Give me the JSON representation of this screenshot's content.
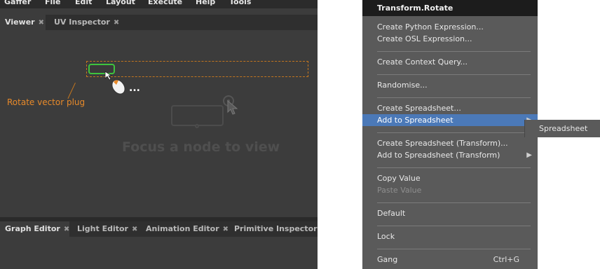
{
  "menubar": {
    "items": [
      "Gaffer",
      "File",
      "Edit",
      "Layout",
      "Execute",
      "Help",
      "Tools"
    ]
  },
  "top_tabs": [
    {
      "label": "Viewer"
    },
    {
      "label": "UV Inspector"
    }
  ],
  "bottom_tabs": [
    {
      "label": "Graph Editor"
    },
    {
      "label": "Light Editor"
    },
    {
      "label": "Animation Editor"
    },
    {
      "label": "Primitive Inspector"
    }
  ],
  "tab_close_glyph": "✖",
  "viewer": {
    "callout": "Rotate vector plug",
    "ellipsis": "...",
    "placeholder": "Focus a node to view"
  },
  "context_menu": {
    "title": "Transform.Rotate",
    "items": [
      "Create Python Expression...",
      "Create OSL Expression...",
      "Create Context Query...",
      "Randomise...",
      "Create Spreadsheet...",
      "Add to Spreadsheet",
      "Create Spreadsheet (Transform)...",
      "Add to Spreadsheet (Transform)",
      "Copy Value",
      "Paste Value",
      "Default",
      "Lock",
      "Gang"
    ],
    "gang_shortcut": "Ctrl+G",
    "highlight_color": "#4b79b8"
  },
  "submenu": {
    "item": "Spreadsheet"
  },
  "colors": {
    "callout": "#e88a2a",
    "plug_highlight": "#3ec43e",
    "menu_bg": "#5a5a5a",
    "window_bg": "#3c3c3c"
  }
}
